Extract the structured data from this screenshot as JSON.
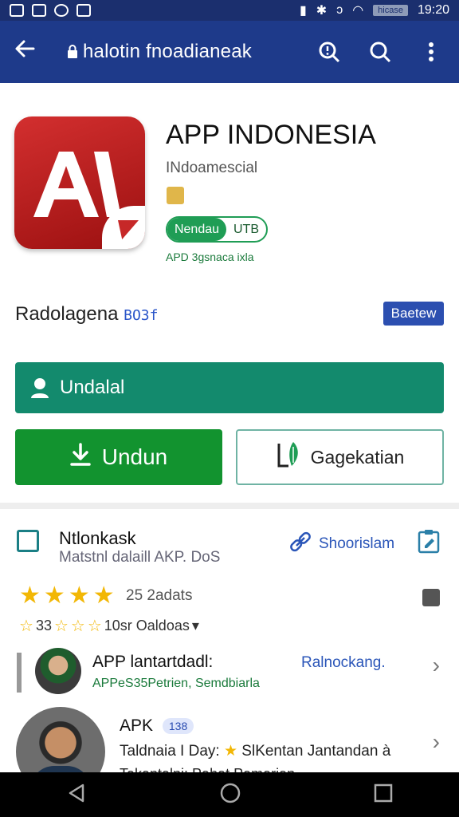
{
  "status_bar": {
    "time": "19:20",
    "battery_label": "hicase"
  },
  "app_bar": {
    "url": "halotin fnoadianeak",
    "icons": [
      "back-arrow-icon",
      "lock-icon",
      "search-zoom-icon",
      "search-icon",
      "more-vert-icon"
    ]
  },
  "app": {
    "title": "APP INDONESIA",
    "developer": "INdoamescial",
    "pill_left": "Nendau",
    "pill_right": "UTB",
    "sub_green": "APD 3gsnaca ixla",
    "colors": {
      "brand_red": "#c62828",
      "accent_green": "#1f9d55",
      "appbar_blue": "#1e3a8a"
    }
  },
  "rating_row": {
    "label": "Radolagena",
    "tag": "BO3f",
    "review_button": "Baetew"
  },
  "buttons": {
    "primary_label": "Undalal",
    "download_label": "Undun",
    "secondary_label": "Gagekatian"
  },
  "section": {
    "title": "Ntlonkask",
    "subtitle": "Matstnl dalaill AKP. DoS",
    "share_label": "Shoorislam",
    "rating_text": "25 2adats",
    "stars_filled": 4,
    "small_stars_prefix": "33",
    "small_stars_text": "10sr Oaldoas",
    "small_stars_caret": "▾"
  },
  "list": [
    {
      "title": "APP lantartdadl:",
      "link": "Ralnockang.",
      "sub": "APPeS35Petrien, Semdbiarla"
    },
    {
      "title": "APK",
      "badge": "138",
      "line": "Taldnaia I Day:",
      "star": "★",
      "line_rest": "SlKentan Jantandan à",
      "cut": "Takantalni: Pahat Pamarian"
    }
  ]
}
